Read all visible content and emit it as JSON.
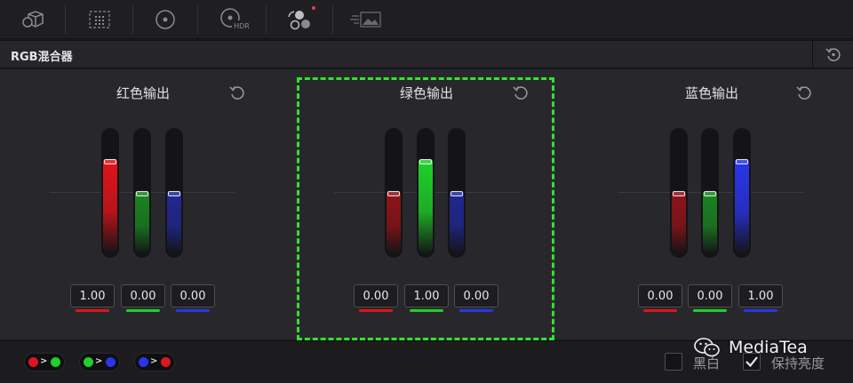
{
  "toolbar": {
    "tools": [
      {
        "icon": "cube-icon"
      },
      {
        "icon": "matrix-grid-icon"
      },
      {
        "icon": "color-wheel-icon"
      },
      {
        "icon": "hdr-wheel-icon",
        "label": "HDR"
      },
      {
        "icon": "rgb-mixer-icon",
        "notification": true
      },
      {
        "icon": "motion-effects-icon"
      }
    ]
  },
  "header": {
    "title": "RGB混合器",
    "reset_icon": "reset-all-icon"
  },
  "panels": [
    {
      "title": "红色输出",
      "values": [
        "1.00",
        "0.00",
        "0.00"
      ],
      "levels": [
        1.0,
        0.0,
        0.0
      ]
    },
    {
      "title": "绿色输出",
      "values": [
        "0.00",
        "1.00",
        "0.00"
      ],
      "levels": [
        0.0,
        1.0,
        0.0
      ]
    },
    {
      "title": "蓝色输出",
      "values": [
        "0.00",
        "0.00",
        "1.00"
      ],
      "levels": [
        0.0,
        0.0,
        1.0
      ]
    }
  ],
  "colors": {
    "red": "#e0141c",
    "green": "#1fd12a",
    "blue": "#2b35e8",
    "highlight": "#2ee52e",
    "panel_bg": "#28282c"
  },
  "bottom": {
    "presets": [
      {
        "name": "swap-red-green",
        "from": "red",
        "to": "green"
      },
      {
        "name": "swap-green-blue",
        "from": "green",
        "to": "blue"
      },
      {
        "name": "swap-blue-red",
        "from": "blue",
        "to": "red"
      }
    ],
    "monochrome_label": "黑白",
    "monochrome_checked": false,
    "preserve_luminance_label": "保持亮度",
    "preserve_luminance_checked": true
  },
  "watermark": {
    "text": "MediaTea"
  }
}
